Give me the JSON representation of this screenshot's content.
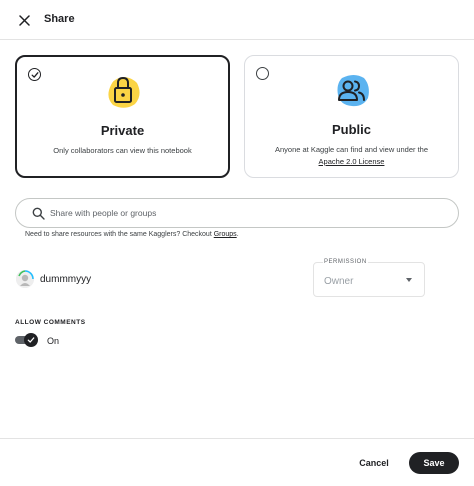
{
  "header": {
    "title": "Share",
    "close_icon": "close-icon"
  },
  "visibility": {
    "private": {
      "title": "Private",
      "description": "Only collaborators can view this notebook",
      "selected": true,
      "icon": "lock-icon",
      "accent": "#fbd445"
    },
    "public": {
      "title": "Public",
      "description": "Anyone at Kaggle can find and view under the",
      "license_link": "Apache 2.0 License",
      "selected": false,
      "icon": "people-icon",
      "accent": "#5bb3f0"
    }
  },
  "search": {
    "placeholder": "Share with people or groups",
    "value": ""
  },
  "hint": {
    "text": "Need to share resources with the same Kagglers? Checkout ",
    "link": "Groups",
    "suffix": "."
  },
  "collaborator": {
    "username": "dummmyyy",
    "permission_label": "PERMISSION",
    "permission_value": "Owner"
  },
  "comments": {
    "label": "ALLOW COMMENTS",
    "state_label": "On",
    "enabled": true
  },
  "footer": {
    "cancel_label": "Cancel",
    "save_label": "Save"
  },
  "colors": {
    "primary": "#202124",
    "border": "#dadce0"
  }
}
